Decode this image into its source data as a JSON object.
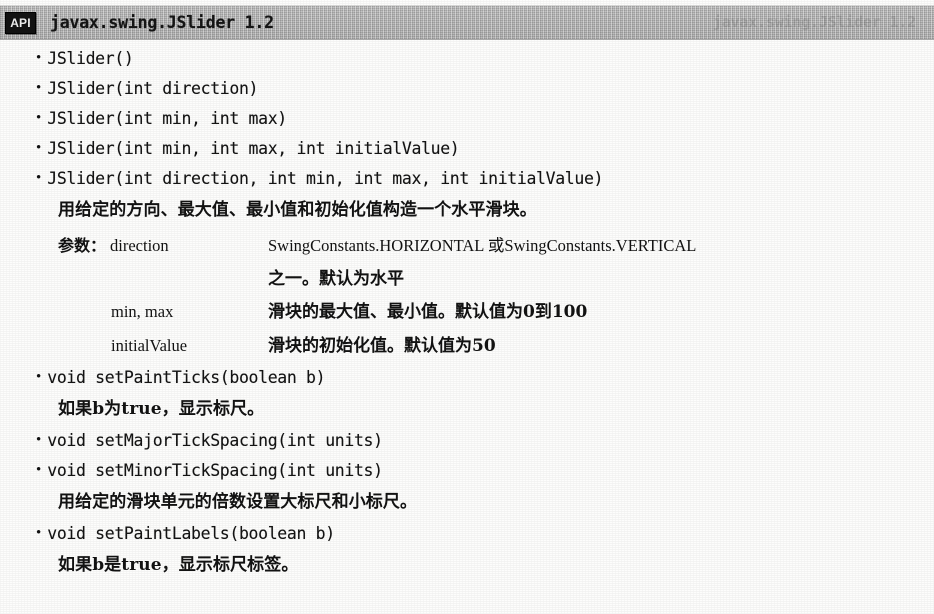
{
  "header": {
    "badge": "API",
    "title": "javax.swing.JSlider 1.2",
    "ghost": "javax.swing.JSlider 1.2"
  },
  "entries": [
    {
      "signature": "JSlider()",
      "bullet": "•"
    },
    {
      "signature": "JSlider(int direction)",
      "bullet": "•"
    },
    {
      "signature": "JSlider(int min, int max)",
      "bullet": "•"
    },
    {
      "signature": "JSlider(int min, int max, int initialValue)",
      "bullet": "•"
    },
    {
      "signature": "JSlider(int direction, int min, int max, int initialValue)",
      "bullet": "•",
      "description": "用给定的方向、最大值、最小值和初始化值构造一个水平滑块。"
    },
    {
      "signature": "void setPaintTicks(boolean b)",
      "bullet": "•",
      "description": "如果b为true，显示标尺。"
    },
    {
      "signature": "void setMajorTickSpacing(int units)",
      "bullet": "•"
    },
    {
      "signature": "void setMinorTickSpacing(int units)",
      "bullet": "•",
      "description": "用给定的滑块单元的倍数设置大标尺和小标尺。"
    },
    {
      "signature": "void setPaintLabels(boolean b)",
      "bullet": "•",
      "description": "如果b是true，显示标尺标签。"
    }
  ],
  "params": {
    "label": "参数：",
    "rows": [
      {
        "name": "direction",
        "value": "SwingConstants.HORIZONTAL 或SwingConstants.VERTICAL",
        "value_is_cjk": false,
        "continuation": "之一。默认为水平"
      },
      {
        "name": "min, max",
        "value": "滑块的最大值、最小值。默认值为0到100",
        "value_is_cjk": true
      },
      {
        "name": "initialValue",
        "value": "滑块的初始化值。默认值为50",
        "value_is_cjk": true
      }
    ]
  }
}
